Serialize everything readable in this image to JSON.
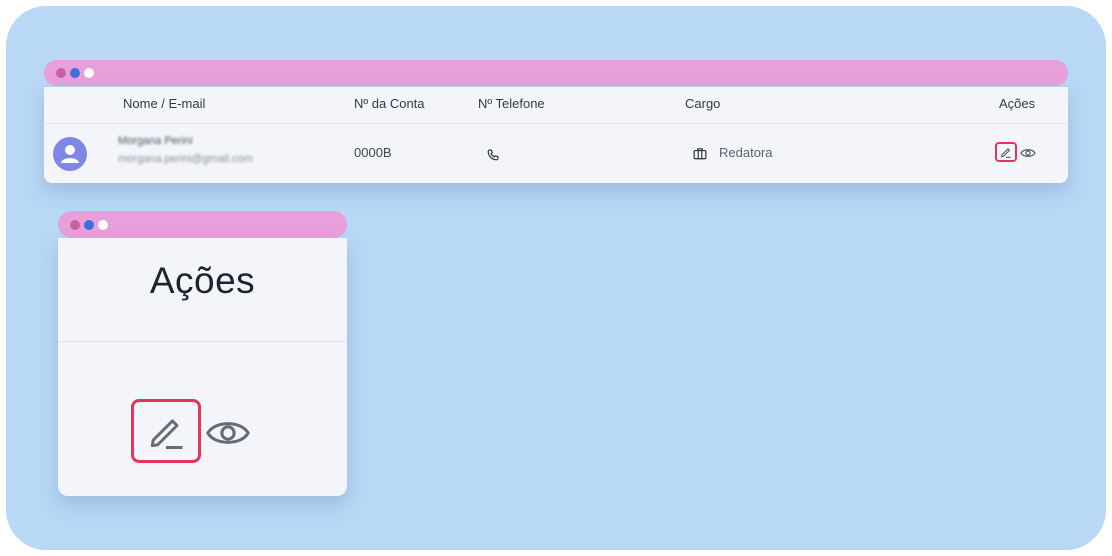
{
  "window_colors": {
    "dot1": "#c6629f",
    "dot2": "#3d6fd8",
    "dot3": "#ffffff",
    "bar": "#e7a0da",
    "highlight": "#e8345d"
  },
  "table": {
    "headers": {
      "name": "Nome / E-mail",
      "account": "Nº da Conta",
      "phone": "Nº Telefone",
      "role": "Cargo",
      "actions": "Ações"
    },
    "row": {
      "name": "Morgana Perini",
      "email": "morgana.perini@gmail.com",
      "account": "0000B",
      "role": "Redatora",
      "icons": [
        "avatar-icon",
        "phone-icon",
        "briefcase-icon",
        "pencil-icon",
        "eye-icon"
      ]
    }
  },
  "zoom": {
    "title": "Ações",
    "icons": [
      "pencil-icon",
      "eye-icon"
    ]
  }
}
